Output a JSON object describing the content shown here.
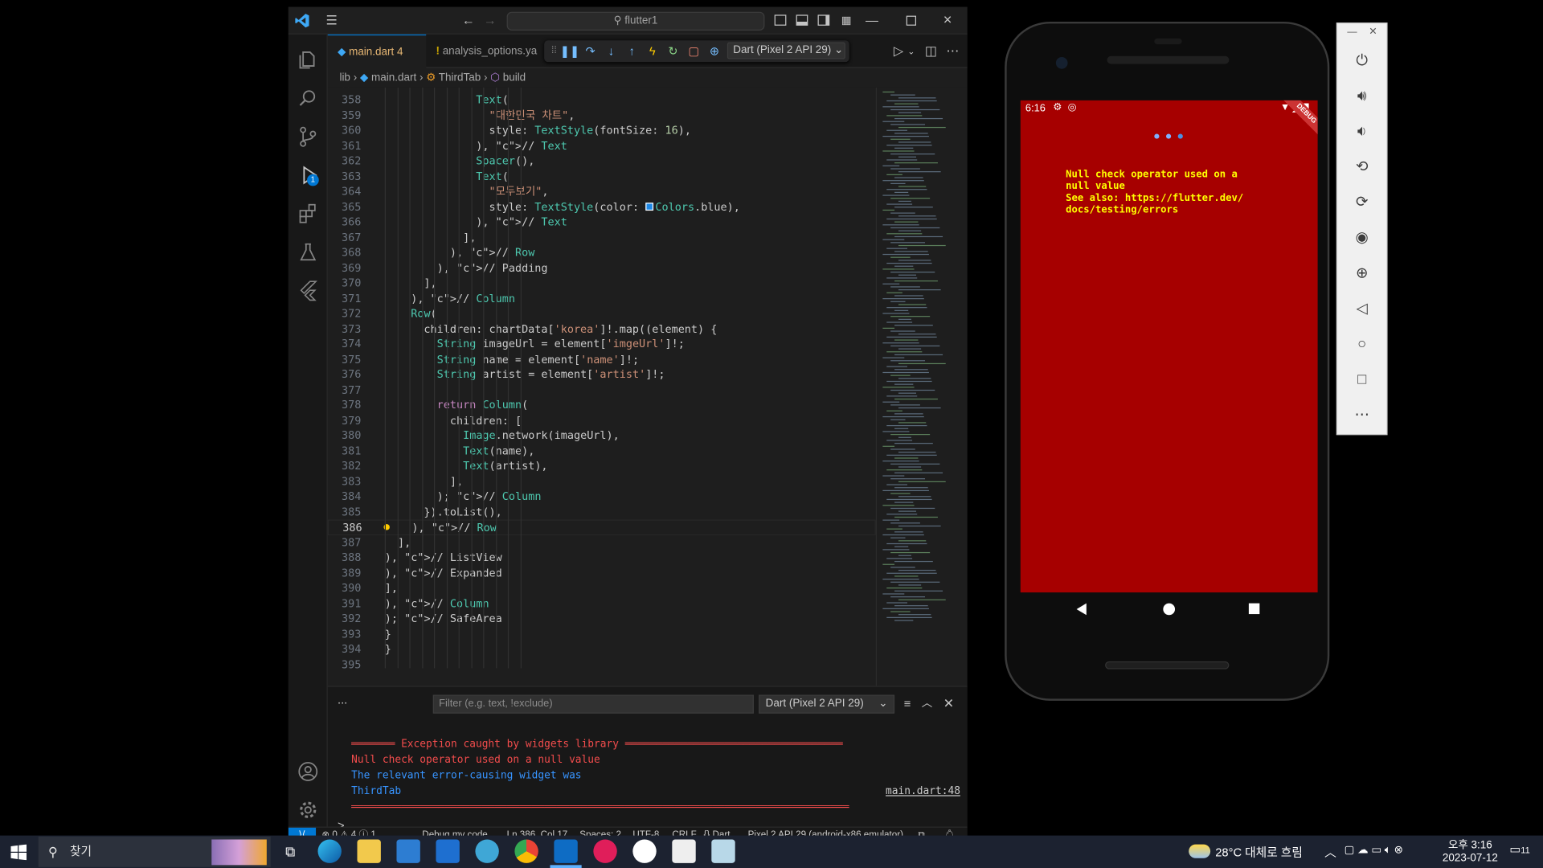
{
  "colors": {
    "accent": "#0078d4",
    "error_red": "#f14c4c",
    "phone_error_bg": "#a60000",
    "phone_error_text": "#ffff00",
    "debug_blue": "#75beff"
  },
  "vscode": {
    "title_search": "flutter1",
    "tabs": [
      {
        "label": "main.dart",
        "badge": "4",
        "active": true,
        "icon": "dart-icon"
      },
      {
        "label": "analysis_options.ya",
        "active": false,
        "icon": "warning-icon"
      }
    ],
    "debug_device_select": "Dart (Pixel 2 API 29)",
    "breadcrumb": [
      "lib",
      "main.dart",
      "ThirdTab",
      "build"
    ],
    "activity_badge": "1",
    "code_lines": [
      {
        "n": "358",
        "text": "              Text("
      },
      {
        "n": "359",
        "text": "                \"대한민국 차트\","
      },
      {
        "n": "360",
        "text": "                style: TextStyle(fontSize: 16),"
      },
      {
        "n": "361",
        "text": "              ), // Text"
      },
      {
        "n": "362",
        "text": "              Spacer(),"
      },
      {
        "n": "363",
        "text": "              Text("
      },
      {
        "n": "364",
        "text": "                \"모두보기\","
      },
      {
        "n": "365",
        "text": "                style: TextStyle(color: ■Colors.blue),"
      },
      {
        "n": "366",
        "text": "              ), // Text"
      },
      {
        "n": "367",
        "text": "            ],"
      },
      {
        "n": "368",
        "text": "          ), // Row"
      },
      {
        "n": "369",
        "text": "        ), // Padding"
      },
      {
        "n": "370",
        "text": "      ],"
      },
      {
        "n": "371",
        "text": "    ), // Column"
      },
      {
        "n": "372",
        "text": "    Row("
      },
      {
        "n": "373",
        "text": "      children: chartData['korea']!.map((element) {"
      },
      {
        "n": "374",
        "text": "        String imageUrl = element['imgeUrl']!;"
      },
      {
        "n": "375",
        "text": "        String name = element['name']!;"
      },
      {
        "n": "376",
        "text": "        String artist = element['artist']!;"
      },
      {
        "n": "377",
        "text": ""
      },
      {
        "n": "378",
        "text": "        return Column("
      },
      {
        "n": "379",
        "text": "          children: ["
      },
      {
        "n": "380",
        "text": "            Image.network(imageUrl),"
      },
      {
        "n": "381",
        "text": "            Text(name),"
      },
      {
        "n": "382",
        "text": "            Text(artist),"
      },
      {
        "n": "383",
        "text": "          ],"
      },
      {
        "n": "384",
        "text": "        ); // Column"
      },
      {
        "n": "385",
        "text": "      }).toList(),"
      },
      {
        "n": "386",
        "text": "    ), // Row"
      },
      {
        "n": "387",
        "text": "  ],"
      },
      {
        "n": "388",
        "text": "), // ListView"
      },
      {
        "n": "389",
        "text": "), // Expanded"
      },
      {
        "n": "390",
        "text": "],"
      },
      {
        "n": "391",
        "text": "), // Column"
      },
      {
        "n": "392",
        "text": "); // SafeArea"
      },
      {
        "n": "393",
        "text": "}"
      },
      {
        "n": "394",
        "text": "}"
      },
      {
        "n": "395",
        "text": ""
      }
    ],
    "panel": {
      "ellipsis": "...",
      "filter_placeholder": "Filter (e.g. text, !exclude)",
      "device_select": "Dart (Pixel 2 API 29)",
      "output": [
        "═══════ Exception caught by widgets library ═══════════════════════════════════",
        "Null check operator used on a null value",
        "The relevant error-causing widget was",
        "ThirdTab",
        "════════════════════════════════════════════════════════════════════════════════"
      ],
      "link": "main.dart:48",
      "prompt": ">"
    },
    "statusbar": {
      "problems": "⊗ 0 ⚠ 4 ⓘ 1",
      "debug": "Debug my code",
      "position": "Ln 386, Col 17",
      "spaces": "Spaces: 2",
      "encoding": "UTF-8",
      "eol": "CRLF",
      "language": "{} Dart",
      "device": "Pixel 2 API 29 (android-x86 emulator)"
    }
  },
  "phone": {
    "time": "6:16",
    "debug_banner": "DEBUG",
    "error_text": "Null check operator used on a\nnull value\nSee also: https://flutter.dev/\ndocs/testing/errors"
  },
  "emulator_toolbar": {
    "buttons": [
      "power-icon",
      "volume-up-icon",
      "volume-down-icon",
      "rotate-left-icon",
      "rotate-right-icon",
      "camera-icon",
      "zoom-icon",
      "back-icon",
      "home-icon",
      "overview-icon",
      "more-icon"
    ]
  },
  "taskbar": {
    "search_label": "찾기",
    "weather": "28°C  대체로 흐림",
    "time": "오후 3:16",
    "date": "2023-07-12",
    "notifications": "11"
  }
}
